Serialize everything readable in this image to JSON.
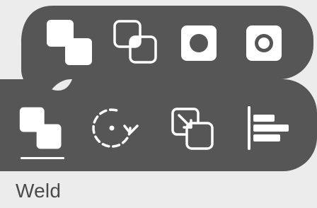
{
  "panel": {
    "label": "Weld",
    "active_tool": "weld",
    "background_color": "#565656",
    "icon_color": "#ffffff"
  },
  "flyout_options": [
    {
      "name": "unite",
      "icon": "unite-icon"
    },
    {
      "name": "weld",
      "icon": "weld-overlap-icon"
    },
    {
      "name": "subtract",
      "icon": "subtract-icon"
    },
    {
      "name": "exclude",
      "icon": "exclude-icon"
    }
  ],
  "toolbar_tools": [
    {
      "name": "weld",
      "icon": "weld-icon",
      "selected": true
    },
    {
      "name": "rotate",
      "icon": "rotate-icon",
      "selected": false
    },
    {
      "name": "arrange",
      "icon": "arrange-icon",
      "selected": false
    },
    {
      "name": "align",
      "icon": "align-icon",
      "selected": false
    }
  ]
}
